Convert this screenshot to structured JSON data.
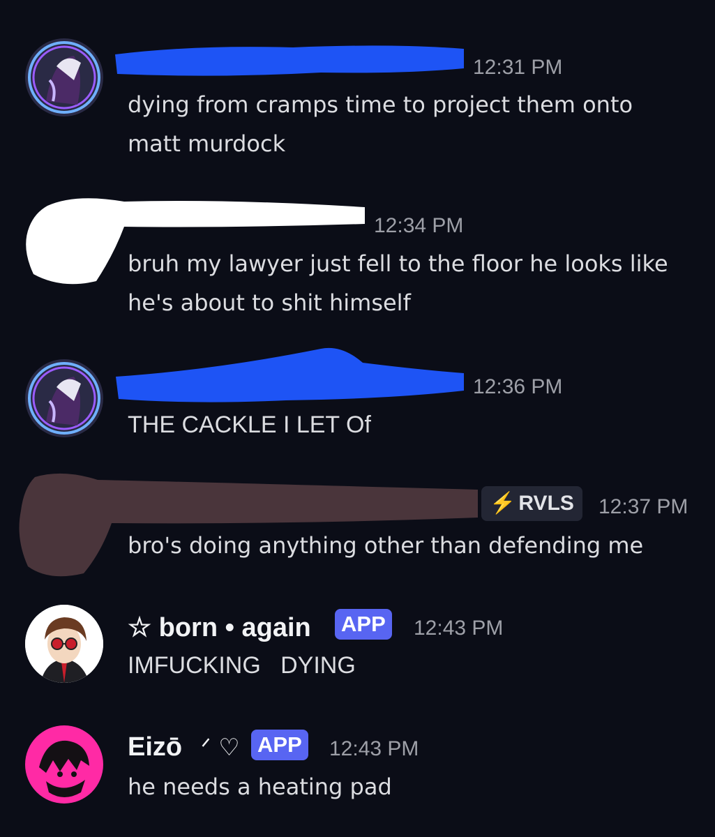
{
  "messages": [
    {
      "time": "12:31 PM",
      "text": "dying from cramps time to project them onto matt murdock",
      "avatar_icon": "anime-character-avatar-icon"
    },
    {
      "time": "12:34 PM",
      "text": "bruh my lawyer just fell to the floor he looks like he's about to shit himself"
    },
    {
      "time": "12:36 PM",
      "text": "THE CACKLE I LET Of",
      "avatar_icon": "anime-character-avatar-icon"
    },
    {
      "time": "12:37 PM",
      "tag": "RVLS",
      "tag_icon": "lightning-icon",
      "text": "bro's doing anything other than defending me"
    },
    {
      "name": "☆ born • again",
      "badge": "APP",
      "time": "12:43 PM",
      "text": "IMFUCKING   DYING",
      "avatar_icon": "cartoon-man-red-glasses-avatar-icon"
    },
    {
      "name": "Eizō",
      "name_suffix": "ᐟ ♡",
      "badge": "APP",
      "time": "12:43 PM",
      "text": "he needs a heating pad",
      "avatar_icon": "pink-anime-avatar-icon"
    }
  ],
  "colors": {
    "background": "#0b0d17",
    "app_badge": "#5865f2",
    "blue_redaction": "#1e54f5",
    "white_redaction": "#ffffff",
    "brown_redaction": "#4a353b"
  }
}
